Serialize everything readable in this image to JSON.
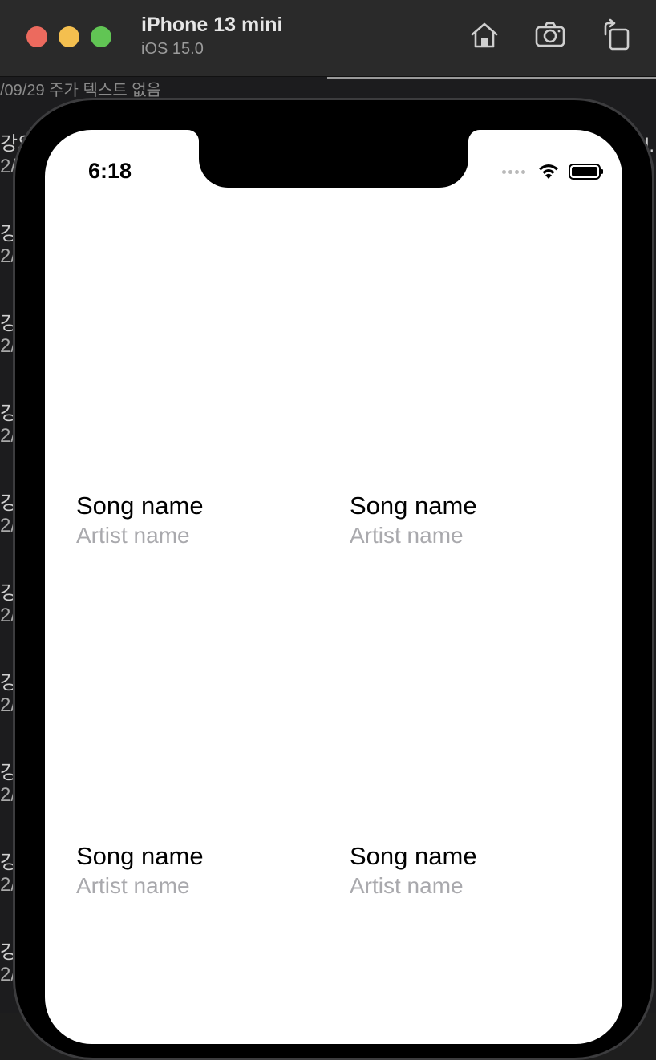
{
  "simulator": {
    "device_name": "iPhone 13 mini",
    "os_version": "iOS 15.0",
    "toolbar_icons": [
      "home-icon",
      "screenshot-icon",
      "rotate-icon"
    ]
  },
  "background": {
    "date_text": "/09/29  주가 텍스트 없음",
    "rows": [
      {
        "title": "강의",
        "sub": "2/0"
      },
      {
        "title": "강",
        "sub": "2/"
      },
      {
        "title": "강",
        "sub": "2/"
      },
      {
        "title": "강",
        "sub": "2/"
      },
      {
        "title": "강",
        "sub": "2/"
      },
      {
        "title": "강",
        "sub": "2/"
      },
      {
        "title": "강",
        "sub": "2/"
      },
      {
        "title": "강",
        "sub": "2/"
      },
      {
        "title": "강",
        "sub": "2/"
      },
      {
        "title": "강",
        "sub": "2/"
      }
    ],
    "right_edge_text": "l."
  },
  "status_bar": {
    "time": "6:18",
    "icons": [
      "signal-icon",
      "wifi-icon",
      "battery-icon"
    ]
  },
  "songs": [
    {
      "song": "Song name",
      "artist": "Artist name"
    },
    {
      "song": "Song name",
      "artist": "Artist name"
    },
    {
      "song": "Song name",
      "artist": "Artist name"
    },
    {
      "song": "Song name",
      "artist": "Artist name"
    }
  ],
  "colors": {
    "titlebar": "#2a2a2a",
    "close": "#ec6a5e",
    "minimize": "#f4bf4f",
    "maximize": "#61c554",
    "artist_text": "#a9a9ad"
  }
}
